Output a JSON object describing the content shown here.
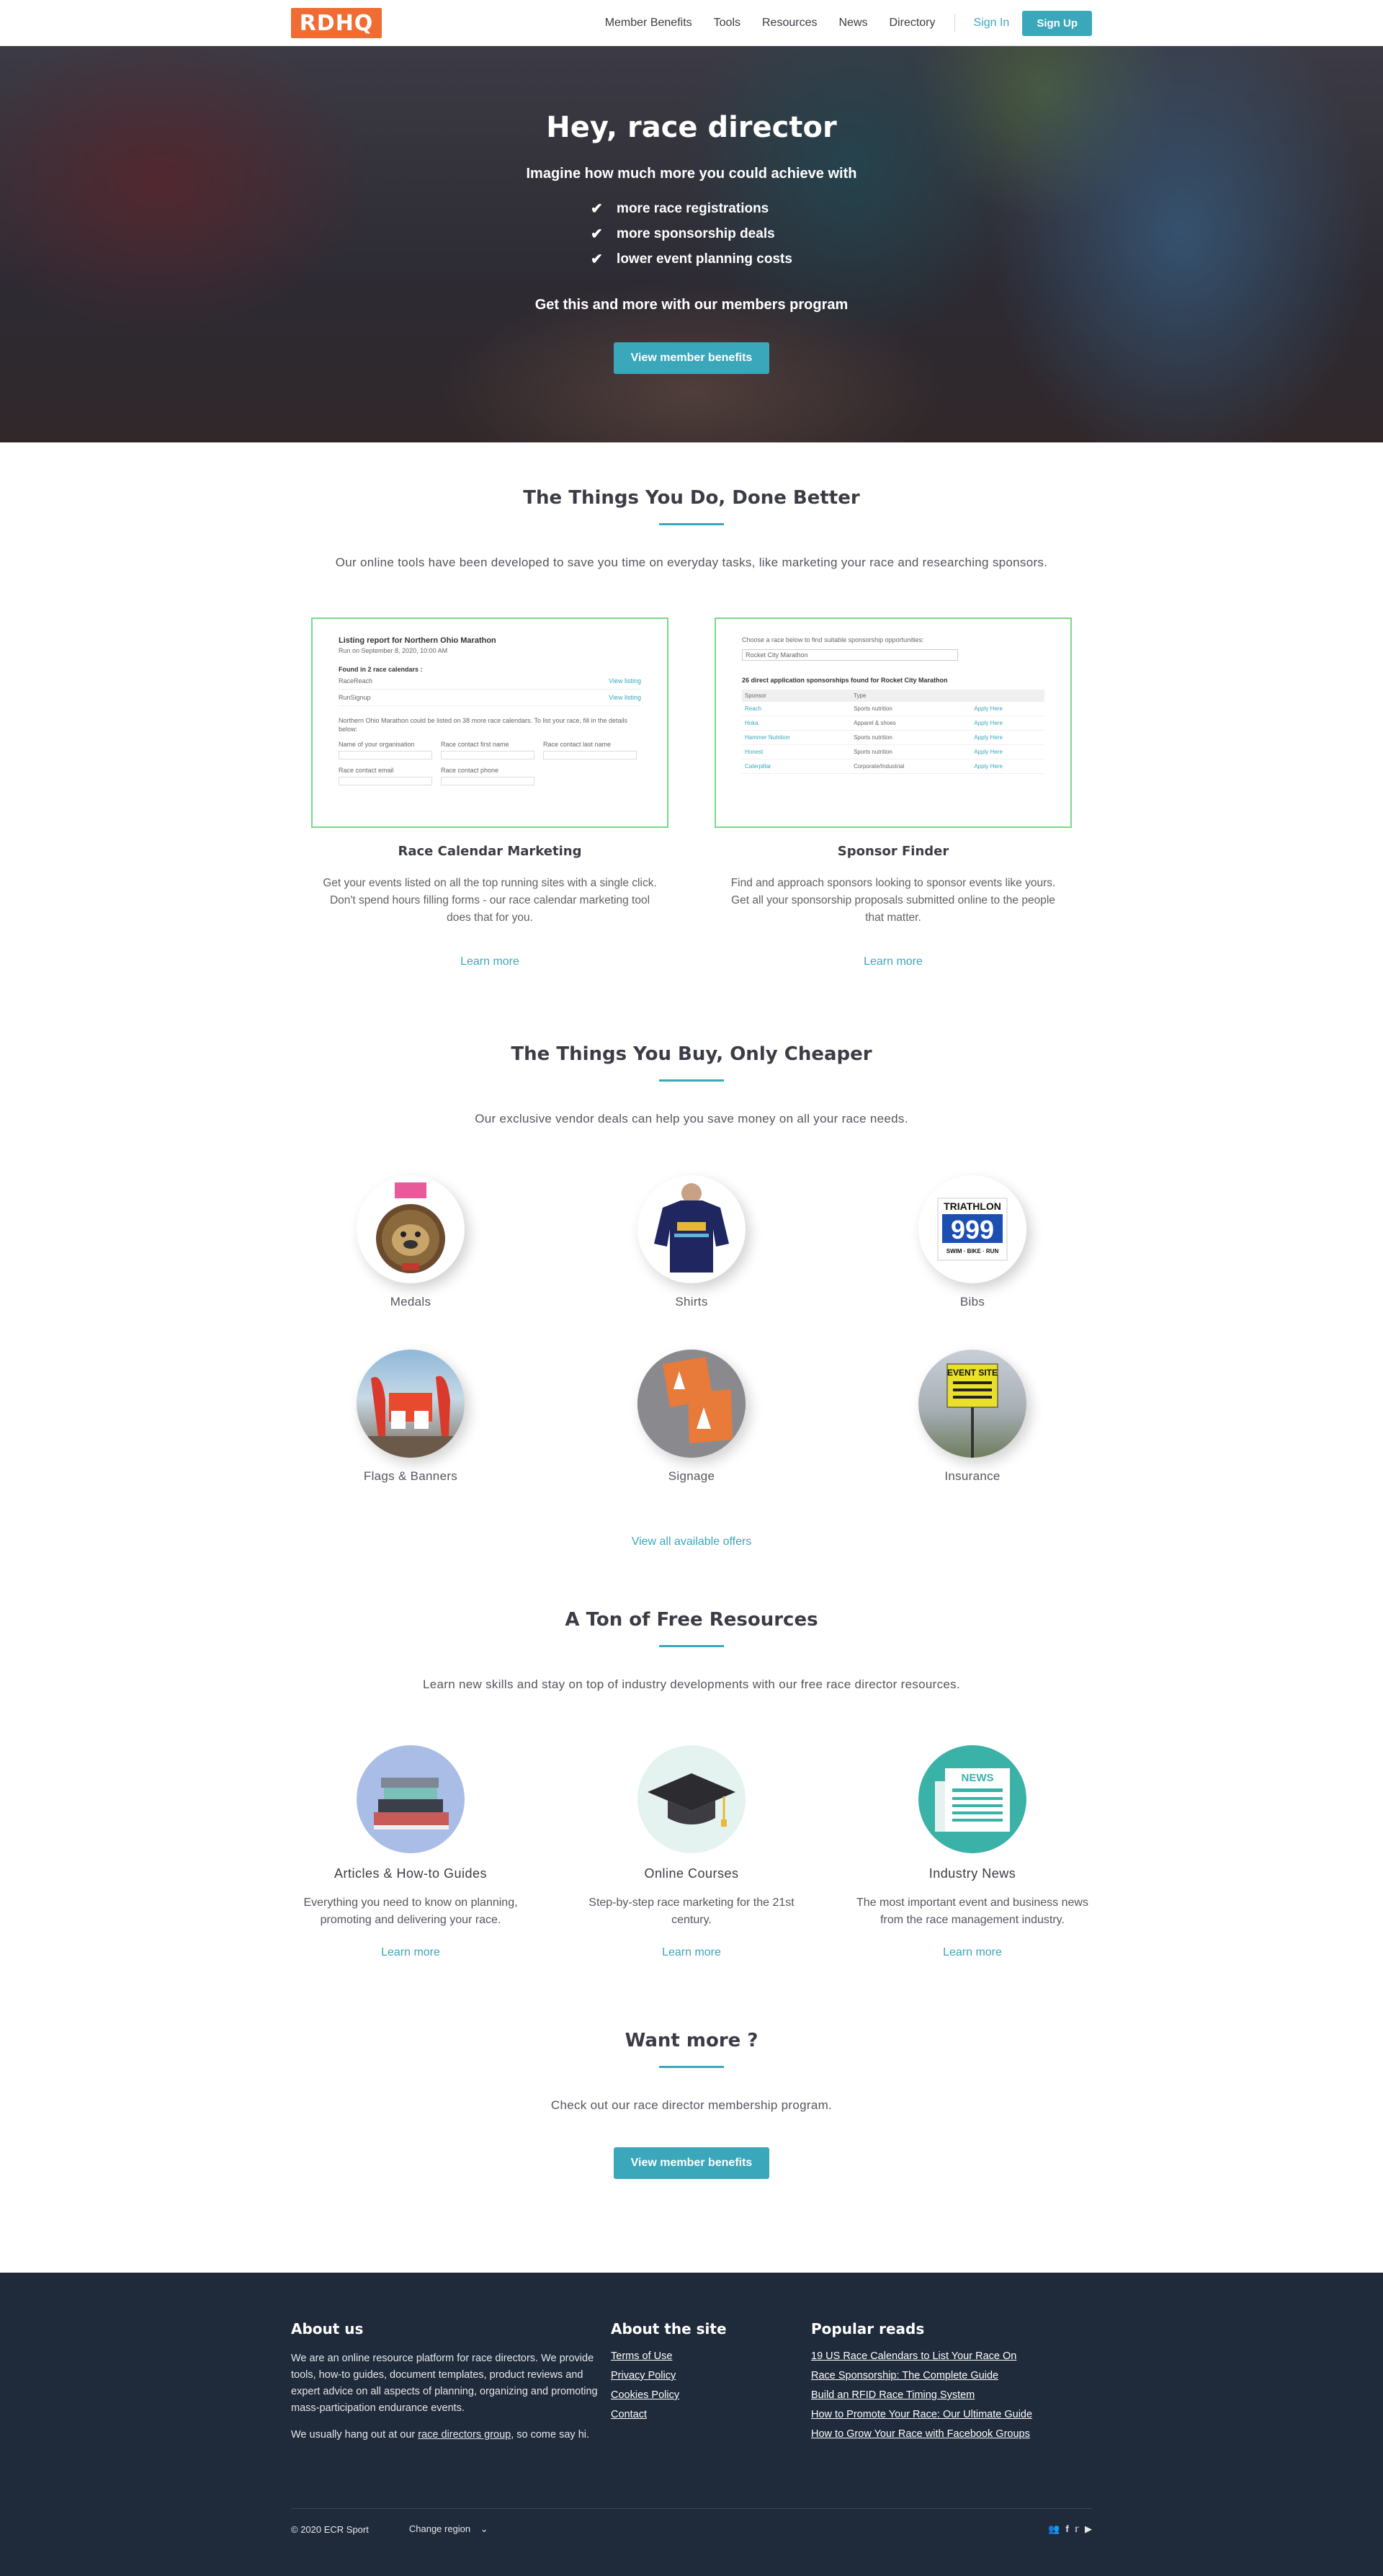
{
  "header": {
    "logo_text": "RDHQ",
    "nav": [
      "Member Benefits",
      "Tools",
      "Resources",
      "News",
      "Directory"
    ],
    "signin": "Sign In",
    "signup": "Sign Up"
  },
  "hero": {
    "title": "Hey, race director",
    "lead": "Imagine how much more you could achieve with",
    "benefits": [
      "more race registrations",
      "more sponsorship deals",
      "lower event planning costs"
    ],
    "check_glyph": "✔",
    "sub": "Get this and more with our members program",
    "button": "View member benefits"
  },
  "things_do": {
    "title": "The Things You Do, Done Better",
    "intro": "Our online tools have been developed to save you time on everyday tasks, like marketing your race and researching sponsors.",
    "tools": [
      {
        "title": "Race Calendar Marketing",
        "desc": "Get your events listed on all the top running sites with a single click. Don't spend hours filling forms - our race calendar marketing tool does that for you.",
        "link": "Learn more",
        "shot": {
          "heading": "Listing report for Northern Ohio Marathon",
          "subheading": "Run on September 8, 2020, 10:00 AM",
          "found": "Found in 2 race calendars :",
          "rows": [
            [
              "RaceReach",
              "View listing"
            ],
            [
              "RunSignup",
              "View listing"
            ]
          ],
          "note": "Northern Ohio Marathon could be listed on 38 more race calendars. To list your race, fill in the details below:",
          "fields": [
            "Name of your organisation",
            "Race contact first name",
            "Race contact last name",
            "Race contact email",
            "Race contact phone"
          ]
        }
      },
      {
        "title": "Sponsor Finder",
        "desc": "Find and approach sponsors looking to sponsor events like yours. Get all your sponsorship proposals submitted online to the people that matter.",
        "link": "Learn more",
        "shot": {
          "prompt": "Choose a race below to find suitable sponsorship opportunities:",
          "select": "Rocket City Marathon",
          "found": "26 direct application sponsorships found for Rocket City Marathon",
          "columns": [
            "Sponsor",
            "Type",
            ""
          ],
          "rows": [
            [
              "Reach",
              "Sports nutrition",
              "Apply Here"
            ],
            [
              "Hoka",
              "Apparel & shoes",
              "Apply Here"
            ],
            [
              "Hammer Nutrition",
              "Sports nutrition",
              "Apply Here"
            ],
            [
              "Honest",
              "Sports nutrition",
              "Apply Here"
            ],
            [
              "Caterpillar",
              "Corporate/Industrial",
              "Apply Here"
            ]
          ]
        }
      }
    ]
  },
  "things_buy": {
    "title": "The Things You Buy, Only Cheaper",
    "intro": "Our exclusive vendor deals can help you save money on all your race needs.",
    "vendors": [
      "Medals",
      "Shirts",
      "Bibs",
      "Flags & Banners",
      "Signage",
      "Insurance"
    ],
    "bib_text": "TRIATHLON",
    "bib_number": "999",
    "bib_footer": "SWIM · BIKE · RUN",
    "insurance_sign": "EVENT SITE",
    "view_all": "View all available offers"
  },
  "resources": {
    "title": "A Ton of Free Resources",
    "intro": "Learn new skills and stay on top of industry developments with our free race director resources.",
    "items": [
      {
        "title": "Articles & How-to Guides",
        "desc": "Everything you need to know on planning, promoting and delivering your race.",
        "link": "Learn more"
      },
      {
        "title": "Online Courses",
        "desc": "Step-by-step race marketing for the 21st century.",
        "link": "Learn more"
      },
      {
        "title": "Industry News",
        "desc": "The most important event and business news from the race management industry.",
        "link": "Learn more"
      }
    ],
    "news_label": "NEWS"
  },
  "want_more": {
    "title": "Want more ?",
    "intro": "Check out our race director membership program.",
    "button": "View member benefits"
  },
  "footer": {
    "about_title": "About us",
    "about_text": "We are an online resource platform for race directors. We provide tools, how-to guides, document templates, product reviews and expert advice on all aspects of planning, organizing and promoting mass-participation endurance events.",
    "hangout_pre": "We usually hang out at our ",
    "hangout_link": "race directors group",
    "hangout_post": ", so come say hi.",
    "site_title": "About the site",
    "site_links": [
      "Terms of Use",
      "Privacy Policy",
      "Cookies Policy",
      "Contact"
    ],
    "popular_title": "Popular reads",
    "popular_links": [
      "19 US Race Calendars to List Your Race On",
      "Race Sponsorship: The Complete Guide",
      "Build an RFID Race Timing System",
      "How to Promote Your Race: Our Ultimate Guide",
      "How to Grow Your Race with Facebook Groups"
    ],
    "copyright": "© 2020 ECR Sport",
    "change_region": "Change region",
    "social_icons": [
      "group-icon",
      "facebook-icon",
      "twitter-icon",
      "youtube-icon"
    ]
  }
}
